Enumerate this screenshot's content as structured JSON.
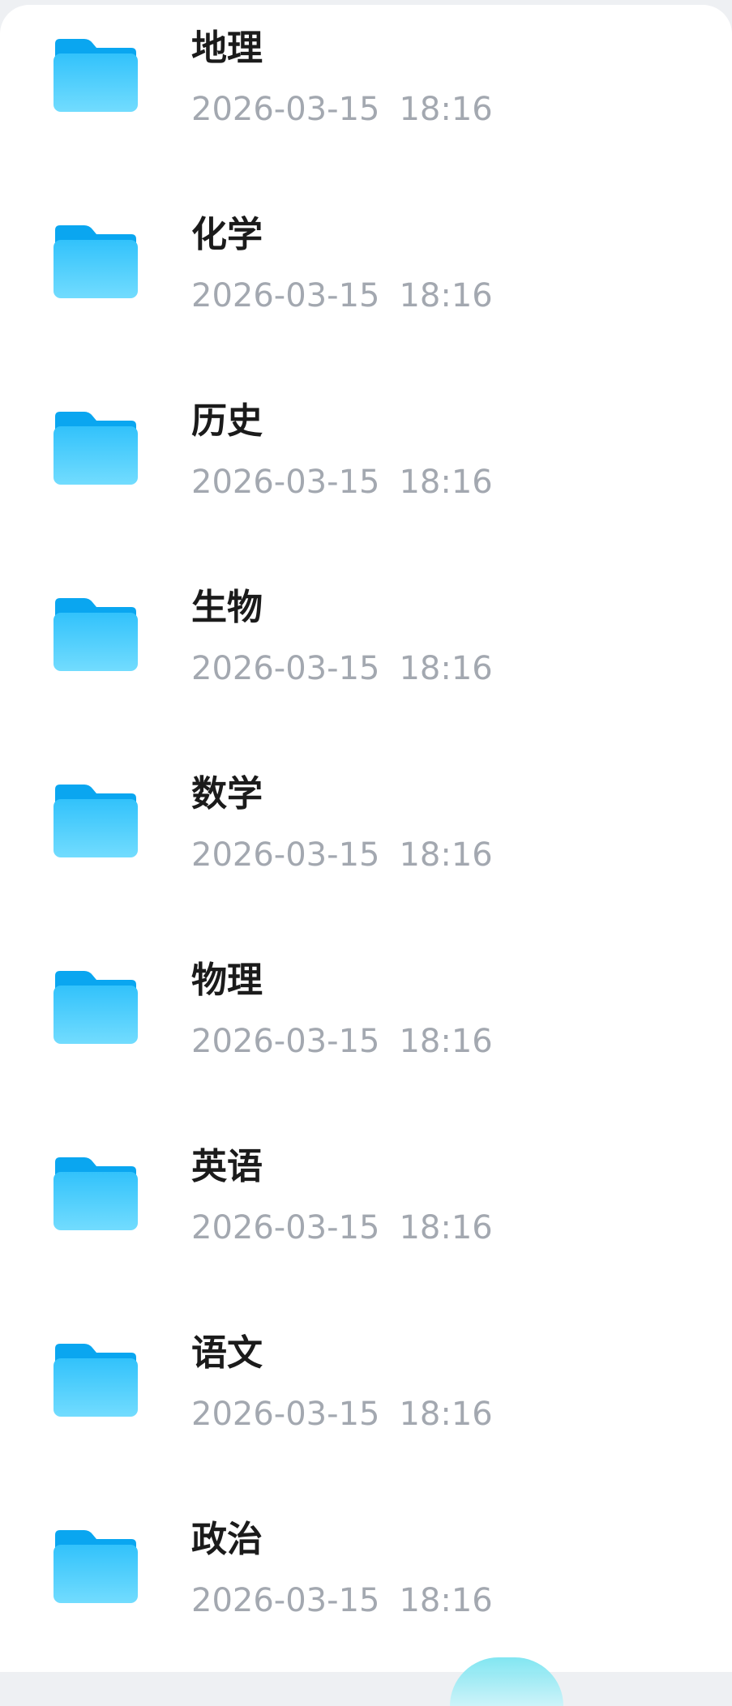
{
  "folders": [
    {
      "name": "地理",
      "date": "2026-03-15",
      "time": "18:16"
    },
    {
      "name": "化学",
      "date": "2026-03-15",
      "time": "18:16"
    },
    {
      "name": "历史",
      "date": "2026-03-15",
      "time": "18:16"
    },
    {
      "name": "生物",
      "date": "2026-03-15",
      "time": "18:16"
    },
    {
      "name": "数学",
      "date": "2026-03-15",
      "time": "18:16"
    },
    {
      "name": "物理",
      "date": "2026-03-15",
      "time": "18:16"
    },
    {
      "name": "英语",
      "date": "2026-03-15",
      "time": "18:16"
    },
    {
      "name": "语文",
      "date": "2026-03-15",
      "time": "18:16"
    },
    {
      "name": "政治",
      "date": "2026-03-15",
      "time": "18:16"
    }
  ],
  "icons": {
    "folder": "folder-icon"
  },
  "colors": {
    "folder_top": "#0aa6f0",
    "folder_body_top": "#32c2fb",
    "folder_body_bottom": "#6fdafd",
    "name_text": "#1b1b1b",
    "meta_text": "#a3a8b0"
  }
}
